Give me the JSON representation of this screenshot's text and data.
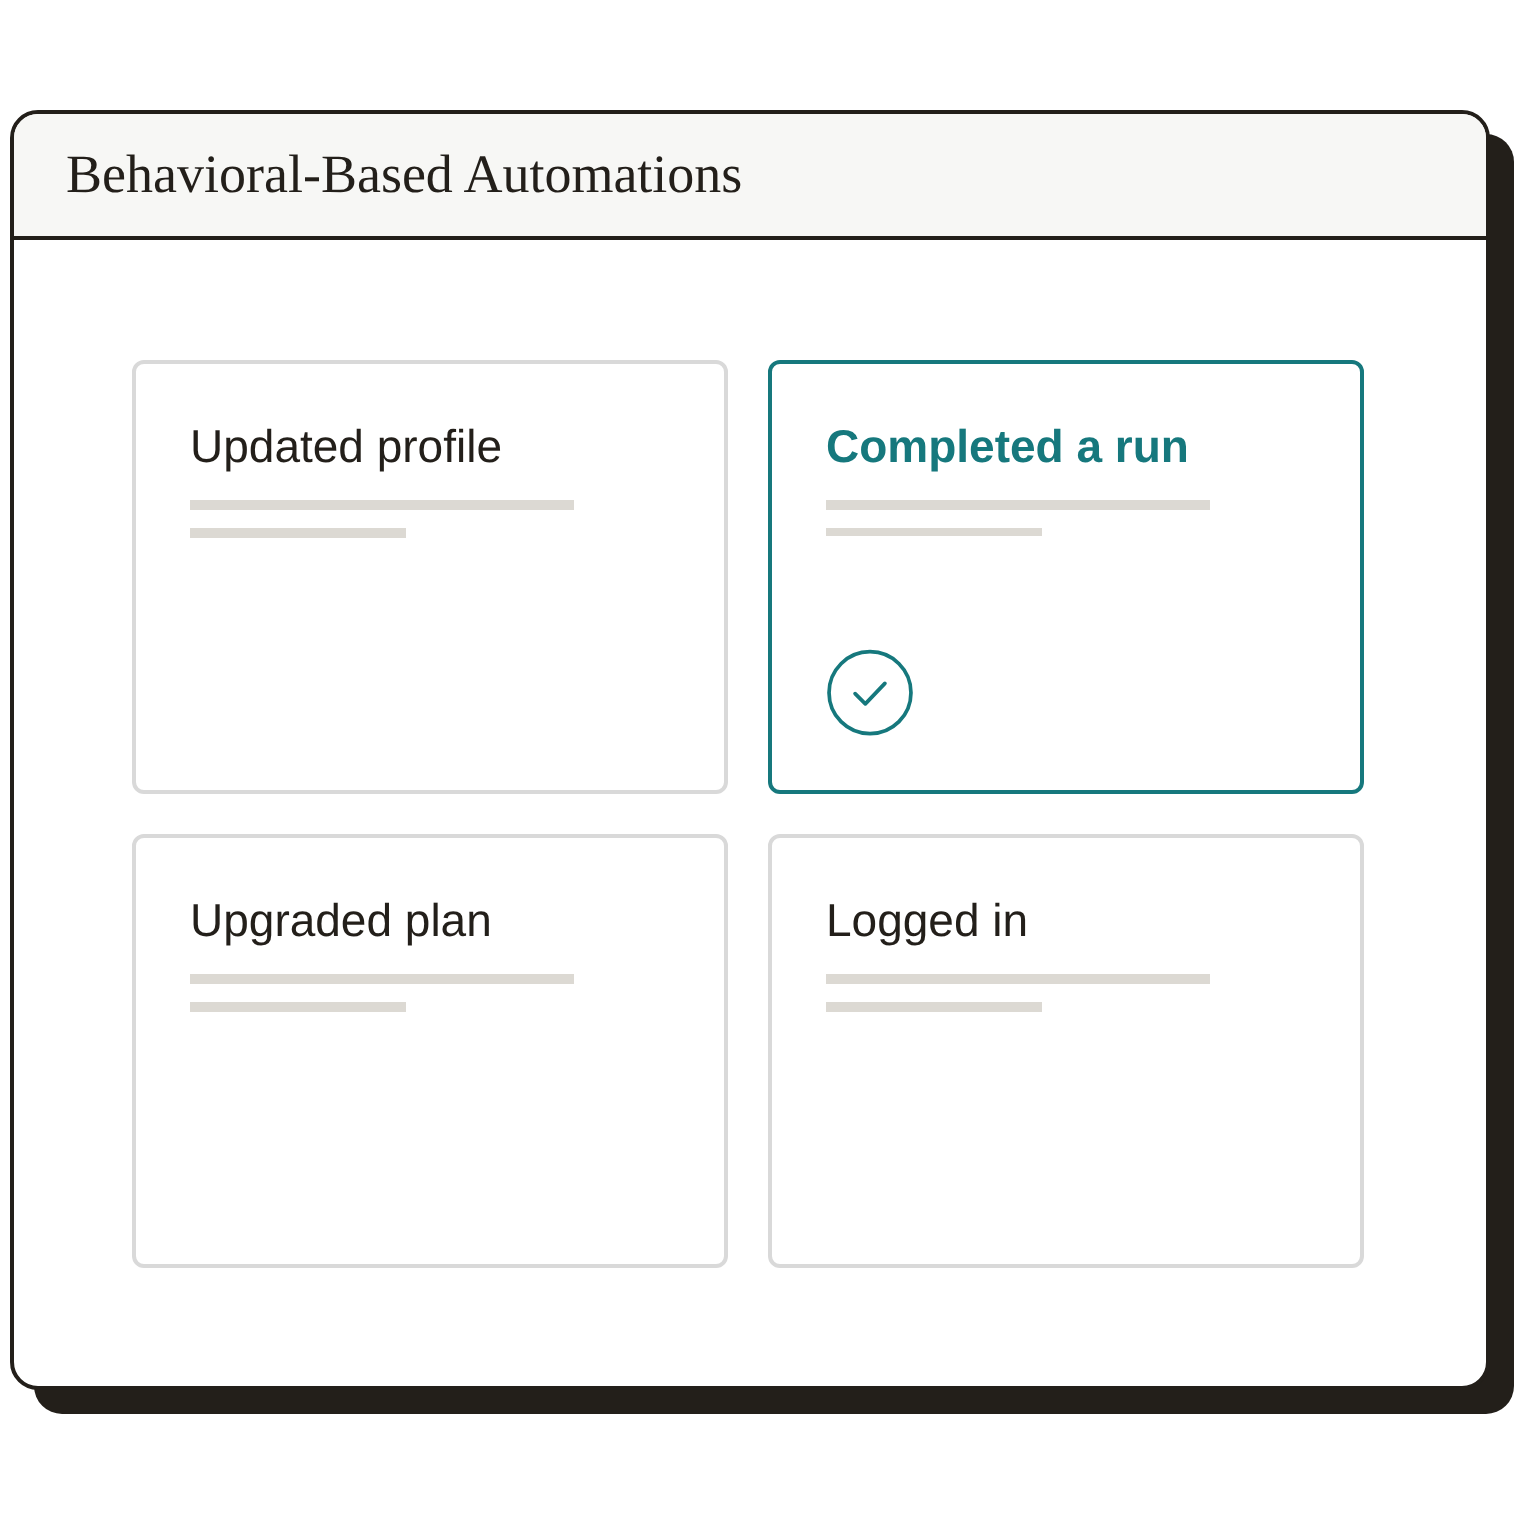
{
  "window": {
    "title": "Behavioral-Based Automations"
  },
  "cards": [
    {
      "label": "Updated profile",
      "selected": false
    },
    {
      "label": "Completed a run",
      "selected": true
    },
    {
      "label": "Upgraded plan",
      "selected": false
    },
    {
      "label": "Logged in",
      "selected": false
    }
  ]
}
